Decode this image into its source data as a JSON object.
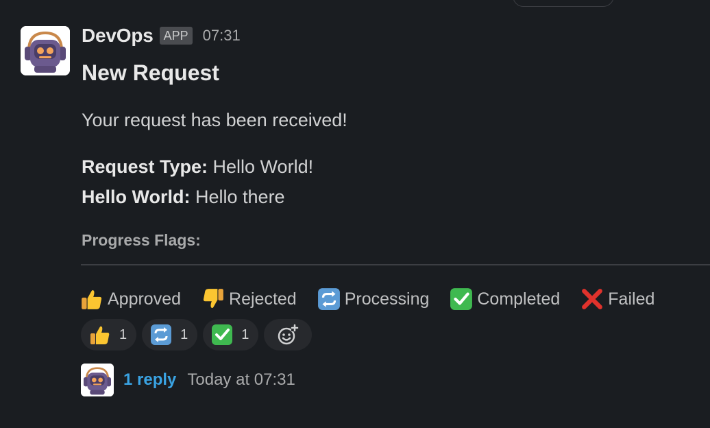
{
  "message": {
    "sender": "DevOps",
    "badge": "APP",
    "time": "07:31",
    "title": "New Request",
    "body": "Your request has been received!",
    "fields": [
      {
        "label": "Request Type:",
        "value": " Hello World!"
      },
      {
        "label": "Hello World:",
        "value": " Hello there"
      }
    ],
    "progress_label": "Progress Flags:"
  },
  "flags": [
    {
      "icon": "thumbs-up-icon",
      "label": "Approved"
    },
    {
      "icon": "thumbs-down-icon",
      "label": "Rejected"
    },
    {
      "icon": "repeat-icon",
      "label": "Processing"
    },
    {
      "icon": "check-mark-icon",
      "label": "Completed"
    },
    {
      "icon": "cross-mark-icon",
      "label": "Failed"
    }
  ],
  "reactions": [
    {
      "icon": "thumbs-up-icon",
      "count": "1"
    },
    {
      "icon": "repeat-icon",
      "count": "1"
    },
    {
      "icon": "check-mark-icon",
      "count": "1"
    }
  ],
  "thread": {
    "reply_text": "1 reply",
    "reply_time": "Today at 07:31"
  },
  "colors": {
    "background": "#1a1d21",
    "link": "#3aa3e3",
    "reaction_pill": "#27292d"
  }
}
